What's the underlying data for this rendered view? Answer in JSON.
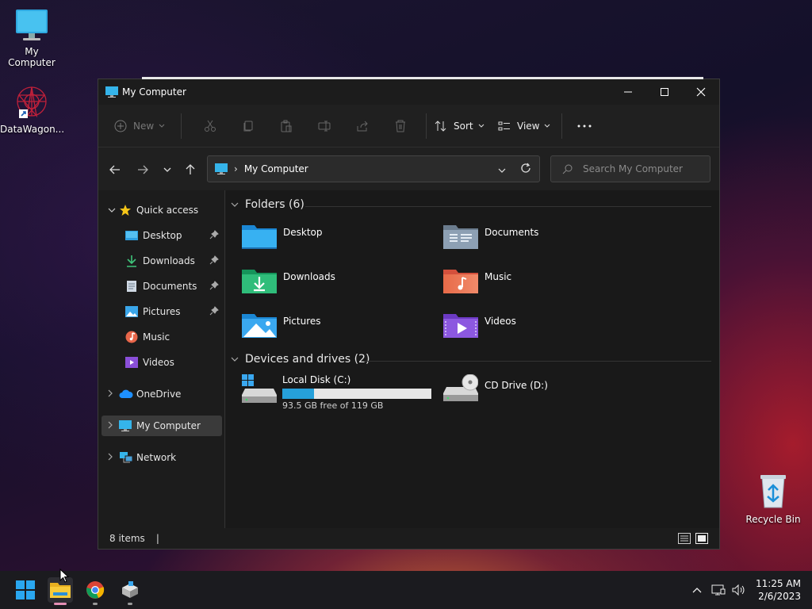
{
  "desktop": {
    "icons": [
      {
        "label": "My Computer",
        "icon": "monitor-icon"
      },
      {
        "label": "DataWagon...",
        "icon": "datawagon-shortcut-icon"
      },
      {
        "label": "Recycle Bin",
        "icon": "recycle-bin-icon"
      }
    ]
  },
  "window": {
    "title": "My Computer",
    "controls": {
      "minimize": "minimize-icon",
      "maximize": "maximize-icon",
      "close": "close-icon"
    }
  },
  "commandbar": {
    "new_label": "New",
    "sort_label": "Sort",
    "view_label": "View",
    "more_icon": "more-icon"
  },
  "address": {
    "path": "My Computer",
    "separator": "›",
    "search_placeholder": "Search My Computer"
  },
  "nav": {
    "quick_access": "Quick access",
    "pinned": [
      {
        "label": "Desktop",
        "pinned": true
      },
      {
        "label": "Downloads",
        "pinned": true
      },
      {
        "label": "Documents",
        "pinned": true
      },
      {
        "label": "Pictures",
        "pinned": true
      },
      {
        "label": "Music",
        "pinned": false
      },
      {
        "label": "Videos",
        "pinned": false
      }
    ],
    "onedrive": "OneDrive",
    "my_computer": "My Computer",
    "network": "Network"
  },
  "content": {
    "folders_header": "Folders (6)",
    "folders": [
      {
        "label": "Desktop"
      },
      {
        "label": "Documents"
      },
      {
        "label": "Downloads"
      },
      {
        "label": "Music"
      },
      {
        "label": "Pictures"
      },
      {
        "label": "Videos"
      }
    ],
    "drives_header": "Devices and drives (2)",
    "drives": [
      {
        "label": "Local Disk (C:)",
        "free_text": "93.5 GB free of 119 GB",
        "used_fraction": 0.214
      },
      {
        "label": "CD Drive (D:)"
      }
    ]
  },
  "statusbar": {
    "items": "8 items",
    "divider": "|"
  },
  "taskbar": {
    "apps": [
      "start-icon",
      "file-explorer-icon",
      "chrome-icon",
      "installer-icon"
    ],
    "tray_icons": [
      "chevron-up-icon",
      "network-icon",
      "volume-icon"
    ],
    "time": "11:25 AM",
    "date": "2/6/2023"
  },
  "colors": {
    "accent": "#0078d4",
    "selected_nav": "#3a3a3a",
    "window_bg": "#1c1c1c"
  }
}
